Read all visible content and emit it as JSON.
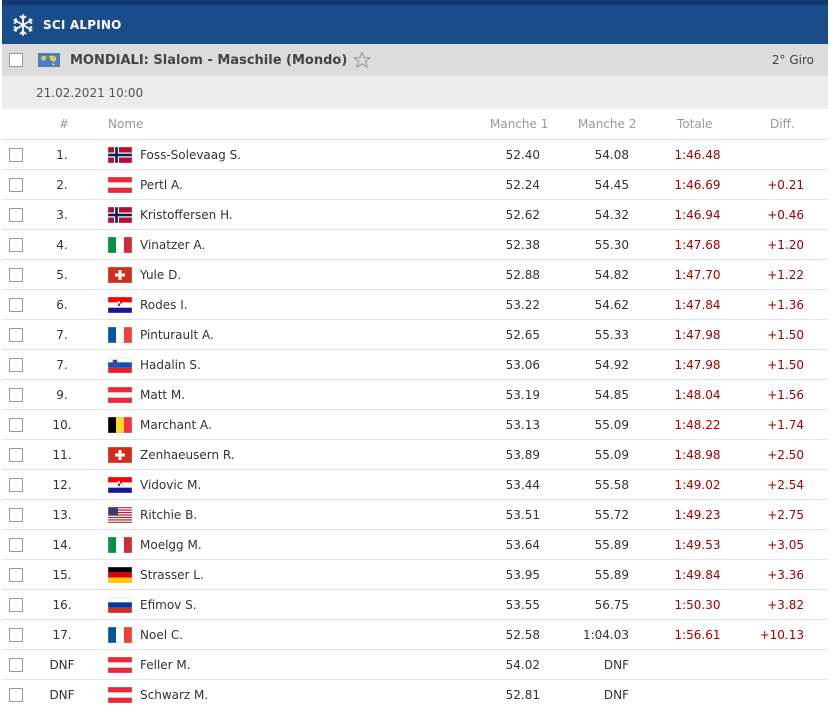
{
  "sport": "SCI ALPINO",
  "event": {
    "title": "MONDIALI: Slalom - Maschile (Mondo)",
    "round": "2° Giro",
    "date": "21.02.2021 10:00"
  },
  "columns": {
    "rank": "#",
    "name": "Nome",
    "run1": "Manche 1",
    "run2": "Manche 2",
    "total": "Totale",
    "diff": "Diff."
  },
  "results": [
    {
      "rank": "1.",
      "flag": "NOR",
      "name": "Foss-Solevaag S.",
      "run1": "52.40",
      "run2": "54.08",
      "total": "1:46.48",
      "diff": ""
    },
    {
      "rank": "2.",
      "flag": "AUT",
      "name": "Pertl A.",
      "run1": "52.24",
      "run2": "54.45",
      "total": "1:46.69",
      "diff": "+0.21"
    },
    {
      "rank": "3.",
      "flag": "NOR",
      "name": "Kristoffersen H.",
      "run1": "52.62",
      "run2": "54.32",
      "total": "1:46.94",
      "diff": "+0.46"
    },
    {
      "rank": "4.",
      "flag": "ITA",
      "name": "Vinatzer A.",
      "run1": "52.38",
      "run2": "55.30",
      "total": "1:47.68",
      "diff": "+1.20"
    },
    {
      "rank": "5.",
      "flag": "SUI",
      "name": "Yule D.",
      "run1": "52.88",
      "run2": "54.82",
      "total": "1:47.70",
      "diff": "+1.22"
    },
    {
      "rank": "6.",
      "flag": "CRO",
      "name": "Rodes I.",
      "run1": "53.22",
      "run2": "54.62",
      "total": "1:47.84",
      "diff": "+1.36"
    },
    {
      "rank": "7.",
      "flag": "FRA",
      "name": "Pinturault A.",
      "run1": "52.65",
      "run2": "55.33",
      "total": "1:47.98",
      "diff": "+1.50"
    },
    {
      "rank": "7.",
      "flag": "SLO",
      "name": "Hadalin S.",
      "run1": "53.06",
      "run2": "54.92",
      "total": "1:47.98",
      "diff": "+1.50"
    },
    {
      "rank": "9.",
      "flag": "AUT",
      "name": "Matt M.",
      "run1": "53.19",
      "run2": "54.85",
      "total": "1:48.04",
      "diff": "+1.56"
    },
    {
      "rank": "10.",
      "flag": "BEL",
      "name": "Marchant A.",
      "run1": "53.13",
      "run2": "55.09",
      "total": "1:48.22",
      "diff": "+1.74"
    },
    {
      "rank": "11.",
      "flag": "SUI",
      "name": "Zenhaeusern R.",
      "run1": "53.89",
      "run2": "55.09",
      "total": "1:48.98",
      "diff": "+2.50"
    },
    {
      "rank": "12.",
      "flag": "CRO",
      "name": "Vidovic M.",
      "run1": "53.44",
      "run2": "55.58",
      "total": "1:49.02",
      "diff": "+2.54"
    },
    {
      "rank": "13.",
      "flag": "USA",
      "name": "Ritchie B.",
      "run1": "53.51",
      "run2": "55.72",
      "total": "1:49.23",
      "diff": "+2.75"
    },
    {
      "rank": "14.",
      "flag": "ITA",
      "name": "Moelgg M.",
      "run1": "53.64",
      "run2": "55.89",
      "total": "1:49.53",
      "diff": "+3.05"
    },
    {
      "rank": "15.",
      "flag": "GER",
      "name": "Strasser L.",
      "run1": "53.95",
      "run2": "55.89",
      "total": "1:49.84",
      "diff": "+3.36"
    },
    {
      "rank": "16.",
      "flag": "RUS",
      "name": "Efimov S.",
      "run1": "53.55",
      "run2": "56.75",
      "total": "1:50.30",
      "diff": "+3.82"
    },
    {
      "rank": "17.",
      "flag": "FRA",
      "name": "Noel C.",
      "run1": "52.58",
      "run2": "1:04.03",
      "total": "1:56.61",
      "diff": "+10.13"
    },
    {
      "rank": "DNF",
      "flag": "AUT",
      "name": "Feller M.",
      "run1": "54.02",
      "run2": "DNF",
      "total": "",
      "diff": ""
    },
    {
      "rank": "DNF",
      "flag": "AUT",
      "name": "Schwarz M.",
      "run1": "52.81",
      "run2": "DNF",
      "total": "",
      "diff": ""
    }
  ],
  "colors": {
    "header_bg": "#1a4b8b",
    "time_red": "#a30000"
  }
}
